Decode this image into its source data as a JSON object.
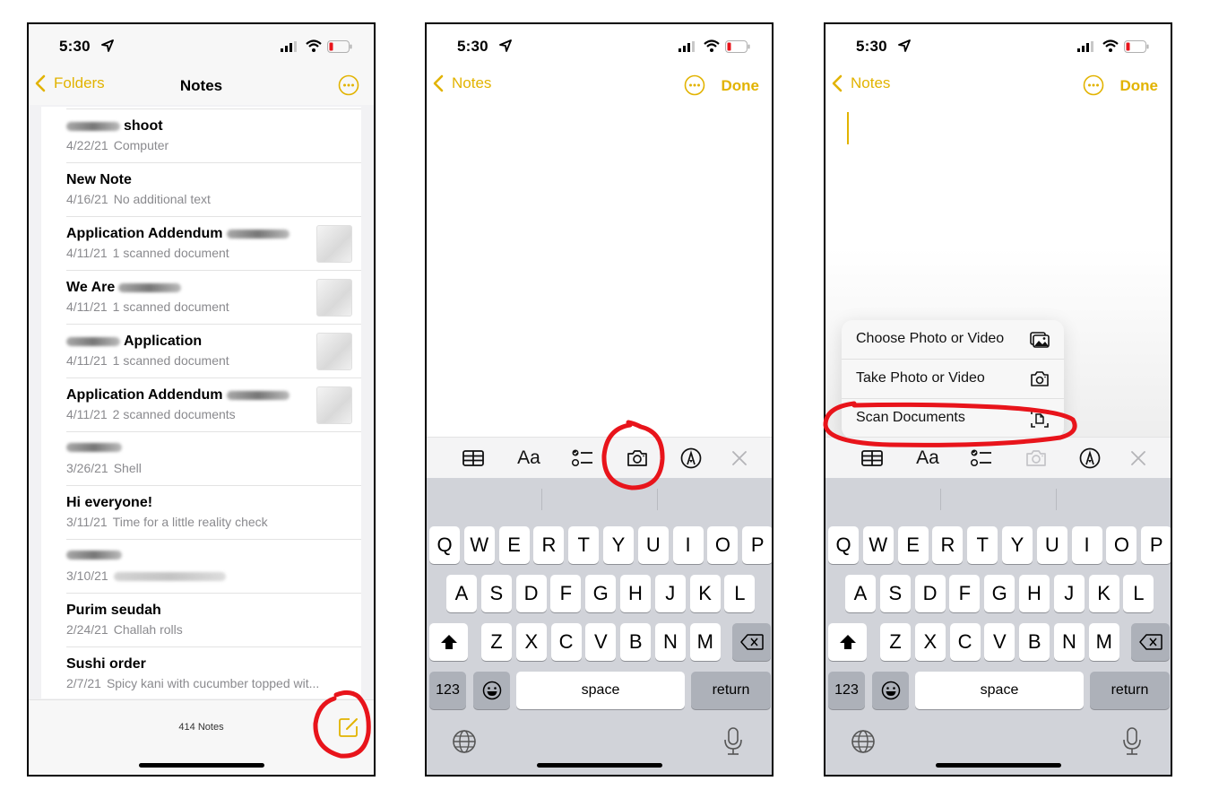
{
  "status_bar": {
    "time": "5:30"
  },
  "colors": {
    "accent": "#e2b300",
    "annotation": "#e8141b",
    "battery_low": "#e8141b"
  },
  "phone1": {
    "nav": {
      "back_label": "Folders",
      "title": "Notes"
    },
    "notes": [
      {
        "title": "shoot",
        "title_redacted_prefix": true,
        "date": "4/22/21",
        "snippet": "Computer",
        "thumbnail": false
      },
      {
        "title": "New Note",
        "date": "4/16/21",
        "snippet": "No additional text",
        "thumbnail": false
      },
      {
        "title": "Application Addendum",
        "title_redacted_suffix": true,
        "date": "4/11/21",
        "snippet": "1 scanned document",
        "thumbnail": true
      },
      {
        "title": "We Are",
        "title_redacted_suffix": true,
        "date": "4/11/21",
        "snippet": "1 scanned document",
        "thumbnail": true
      },
      {
        "title": "Application",
        "title_redacted_prefix": true,
        "date": "4/11/21",
        "snippet": "1 scanned document",
        "thumbnail": true
      },
      {
        "title": "Application Addendum",
        "title_redacted_suffix": true,
        "date": "4/11/21",
        "snippet": "2 scanned documents",
        "thumbnail": true
      },
      {
        "title": "",
        "title_redacted": true,
        "date": "3/26/21",
        "snippet": "Shell",
        "thumbnail": false
      },
      {
        "title": "Hi everyone!",
        "date": "3/11/21",
        "snippet": "Time for a little reality check",
        "thumbnail": false
      },
      {
        "title": "",
        "title_redacted": true,
        "date": "3/10/21",
        "snippet": "",
        "snippet_redacted": true,
        "thumbnail": false
      },
      {
        "title": "Purim seudah",
        "date": "2/24/21",
        "snippet": "Challah rolls",
        "thumbnail": false
      },
      {
        "title": "Sushi order",
        "date": "2/7/21",
        "snippet": "Spicy kani with cucumber topped wit...",
        "thumbnail": false
      }
    ],
    "footer": {
      "count": "414 Notes"
    }
  },
  "phone2": {
    "nav": {
      "back_label": "Notes",
      "done_label": "Done"
    },
    "toolbar": {
      "format_label": "Aa"
    }
  },
  "phone3": {
    "nav": {
      "back_label": "Notes",
      "done_label": "Done"
    },
    "toolbar": {
      "format_label": "Aa"
    },
    "attach_menu": [
      {
        "label": "Choose Photo or Video",
        "icon": "photo-library-icon"
      },
      {
        "label": "Take Photo or Video",
        "icon": "camera-icon"
      },
      {
        "label": "Scan Documents",
        "icon": "scan-document-icon"
      }
    ]
  },
  "keyboard": {
    "row1": [
      "Q",
      "W",
      "E",
      "R",
      "T",
      "Y",
      "U",
      "I",
      "O",
      "P"
    ],
    "row2": [
      "A",
      "S",
      "D",
      "F",
      "G",
      "H",
      "J",
      "K",
      "L"
    ],
    "row3": [
      "Z",
      "X",
      "C",
      "V",
      "B",
      "N",
      "M"
    ],
    "numbers_label": "123",
    "space_label": "space",
    "return_label": "return"
  }
}
